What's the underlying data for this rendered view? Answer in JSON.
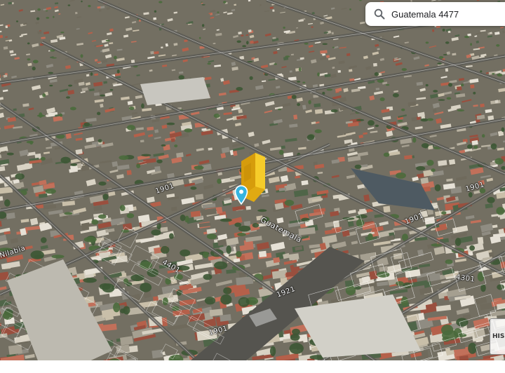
{
  "search": {
    "query": "Guatemala 4477"
  },
  "streets": {
    "main": "Guatemala",
    "labels": [
      "4301",
      "1901",
      "1921",
      "1901",
      "4401",
      "1901",
      "1901"
    ],
    "left_partial": "Nilabia"
  },
  "history_button": {
    "label": "HIS"
  },
  "colors": {
    "pin": "#36b4e0",
    "highlight_building": "#f2c21e",
    "search_bg": "#ffffff"
  }
}
